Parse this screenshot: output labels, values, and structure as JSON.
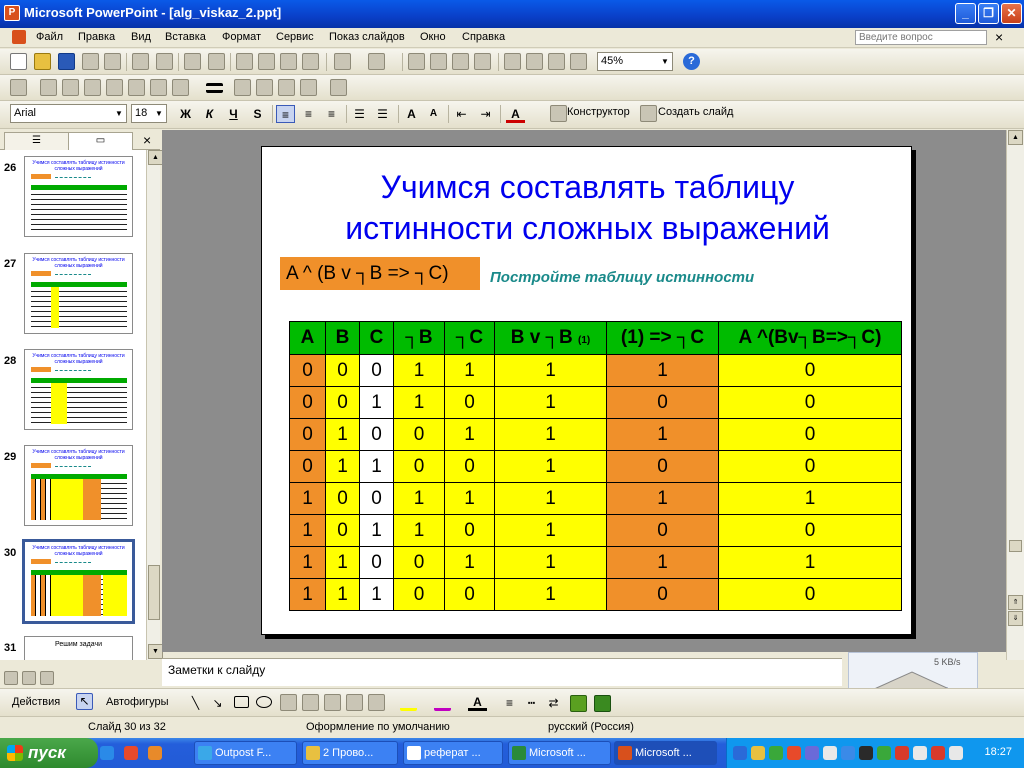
{
  "window": {
    "title": "Microsoft PowerPoint - [alg_viskaz_2.ppt]"
  },
  "menu": {
    "items": [
      "Файл",
      "Правка",
      "Вид",
      "Вставка",
      "Формат",
      "Сервис",
      "Показ слайдов",
      "Окно",
      "Справка"
    ],
    "question_placeholder": "Введите вопрос",
    "close": "×"
  },
  "toolbar": {
    "zoom": "45%"
  },
  "format": {
    "font": "Arial",
    "size": "18",
    "bold": "Ж",
    "italic": "К",
    "underline": "Ч",
    "shadow": "S",
    "designer": "Конструктор",
    "new_slide": "Создать слайд"
  },
  "outline_tabs": {
    "close": "×"
  },
  "thumbnails": [
    {
      "num": "26",
      "title": "Учимся составлять таблицу истинности сложных выражений"
    },
    {
      "num": "27",
      "title": "Учимся составлять таблицу истинности сложных выражений"
    },
    {
      "num": "28",
      "title": "Учимся составлять таблицу истинности сложных выражений"
    },
    {
      "num": "29",
      "title": "Учимся составлять таблицу истинности сложных выражений"
    },
    {
      "num": "30",
      "title": "Учимся составлять таблицу истинности сложных выражений"
    },
    {
      "num": "31",
      "title": "Решим задачи"
    }
  ],
  "slide": {
    "title_line1": "Учимся составлять таблицу",
    "title_line2": "истинности сложных выражений",
    "expression": "A ^ (B v ┐B => ┐C)",
    "hint": "Постройте таблицу истинности",
    "headers": [
      "A",
      "B",
      "C",
      "┐B",
      "┐C",
      "B v ┐B",
      "(1) => ┐C",
      "A ^(Bv┐B=>┐C)"
    ],
    "header_sub": "(1)",
    "rows": [
      [
        "0",
        "0",
        "0",
        "1",
        "1",
        "1",
        "1",
        "0"
      ],
      [
        "0",
        "0",
        "1",
        "1",
        "0",
        "1",
        "0",
        "0"
      ],
      [
        "0",
        "1",
        "0",
        "0",
        "1",
        "1",
        "1",
        "0"
      ],
      [
        "0",
        "1",
        "1",
        "0",
        "0",
        "1",
        "0",
        "0"
      ],
      [
        "1",
        "0",
        "0",
        "1",
        "1",
        "1",
        "1",
        "1"
      ],
      [
        "1",
        "0",
        "1",
        "1",
        "0",
        "1",
        "0",
        "0"
      ],
      [
        "1",
        "1",
        "0",
        "0",
        "1",
        "1",
        "1",
        "1"
      ],
      [
        "1",
        "1",
        "1",
        "0",
        "0",
        "1",
        "0",
        "0"
      ]
    ],
    "colors": {
      "header": "#00bb00",
      "orange": "#f0902a",
      "yellow": "#ffff00",
      "white": "#ffffff",
      "title": "#0000ee",
      "hint": "#1a8a8a"
    }
  },
  "notes": {
    "label": "Заметки к слайду"
  },
  "draw": {
    "actions": "Действия",
    "autoshapes": "Автофигуры"
  },
  "status": {
    "slide": "Слайд 30 из 32",
    "design": "Оформление по умолчанию",
    "lang": "русский (Россия)"
  },
  "netmeter": {
    "rate": "5 KB/s"
  },
  "taskbar": {
    "start": "пуск",
    "tasks": [
      "Outpost F...",
      "2 Прово...",
      "реферат ...",
      "Microsoft ...",
      "Microsoft ..."
    ],
    "clock": "18:27"
  }
}
